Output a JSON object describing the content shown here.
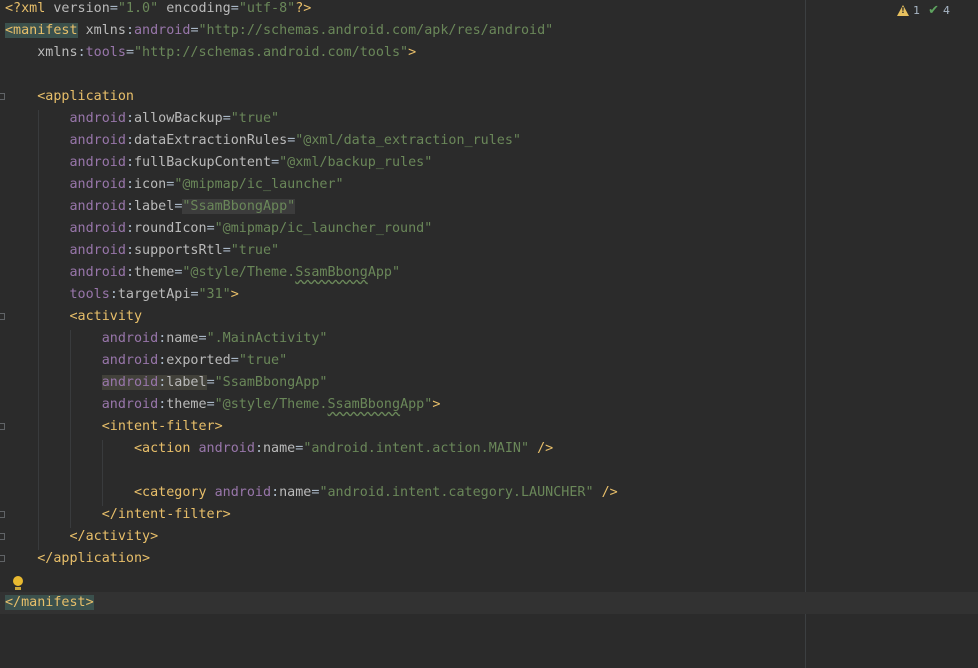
{
  "inspections": {
    "warnings": "1",
    "ok": "4"
  },
  "code": {
    "prolog": {
      "open": "<?xml",
      "version_attr": "version",
      "version_val": "\"1.0\"",
      "encoding_attr": "encoding",
      "encoding_val": "\"utf-8\"",
      "close": "?>"
    },
    "manifest": {
      "open": "<manifest",
      "xmlns": "xmlns",
      "android_prefix": "android",
      "android_ns": "\"http://schemas.android.com/apk/res/android\"",
      "tools_prefix": "tools",
      "tools_ns": "\"http://schemas.android.com/tools\"",
      "close": ">",
      "end": "</manifest>"
    },
    "application": {
      "open": "<application",
      "attrs": [
        {
          "ns": "android",
          "name": "allowBackup",
          "value": "\"true\""
        },
        {
          "ns": "android",
          "name": "dataExtractionRules",
          "value": "\"@xml/data_extraction_rules\""
        },
        {
          "ns": "android",
          "name": "fullBackupContent",
          "value": "\"@xml/backup_rules\""
        },
        {
          "ns": "android",
          "name": "icon",
          "value": "\"@mipmap/ic_launcher\""
        },
        {
          "ns": "android",
          "name": "label",
          "value": "\"SsamBbongApp\""
        },
        {
          "ns": "android",
          "name": "roundIcon",
          "value": "\"@mipmap/ic_launcher_round\""
        },
        {
          "ns": "android",
          "name": "supportsRtl",
          "value": "\"true\""
        }
      ],
      "theme_ns": "android",
      "theme_name": "theme",
      "theme_prefix": "\"@style/Theme.",
      "theme_word": "SsamBbong",
      "theme_suffix": "App\"",
      "target_ns": "tools",
      "target_name": "targetApi",
      "target_value": "\"31\"",
      "close": ">",
      "end": "</application>"
    },
    "activity": {
      "open": "<activity",
      "attrs": [
        {
          "ns": "android",
          "name": "name",
          "value": "\".MainActivity\""
        },
        {
          "ns": "android",
          "name": "exported",
          "value": "\"true\""
        }
      ],
      "label_ns": "android",
      "label_name": "label",
      "label_value": "\"SsamBbongApp\"",
      "theme_ns": "android",
      "theme_name": "theme",
      "theme_prefix": "\"@style/Theme.",
      "theme_word": "SsamBbong",
      "theme_suffix": "App\"",
      "close": ">",
      "end": "</activity>"
    },
    "intent_filter": {
      "open": "<intent-filter>",
      "action_open": "<action",
      "action_ns": "android",
      "action_name": "name",
      "action_value": "\"android.intent.action.MAIN\"",
      "category_open": "<category",
      "category_ns": "android",
      "category_name": "name",
      "category_value": "\"android.intent.category.LAUNCHER\"",
      "self_close": "/>",
      "end": "</intent-filter>"
    }
  }
}
